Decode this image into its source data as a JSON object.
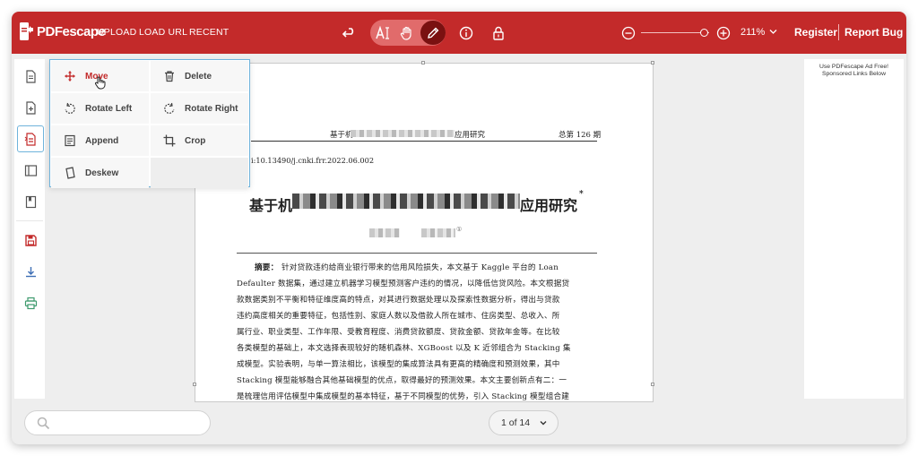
{
  "app": {
    "name": "PDFescape"
  },
  "nav": {
    "upload": "UPLOAD",
    "load_url": "LOAD URL",
    "recent": "RECENT"
  },
  "zoom": {
    "value": "211%",
    "level": 0.94
  },
  "account": {
    "register": "Register",
    "report_bug": "Report Bug"
  },
  "menu": {
    "items": [
      {
        "label": "Move",
        "icon": "move-icon",
        "selected": true
      },
      {
        "label": "Delete",
        "icon": "trash-icon"
      },
      {
        "label": "Rotate Left",
        "icon": "rotate-left-icon"
      },
      {
        "label": "Rotate Right",
        "icon": "rotate-right-icon"
      },
      {
        "label": "Append",
        "icon": "append-icon"
      },
      {
        "label": "Crop",
        "icon": "crop-icon"
      },
      {
        "label": "Deskew",
        "icon": "deskew-icon"
      }
    ]
  },
  "ad": {
    "line1": "Use PDFescape Ad Free!",
    "line2": "Sponsored Links Below"
  },
  "document": {
    "header_left": "基于机",
    "header_right_tail": "应用研究",
    "issue": "总第 126 期",
    "doi": "i:10.13490/j.cnki.frr.2022.06.002",
    "title_start": "基于机",
    "title_end": "应用研究",
    "title_mark": "*",
    "footnote_mark": "①",
    "abstract_label": "摘要：",
    "abstract_lines": [
      "针对贷款违约给商业银行带来的信用风险损失，本文基于 Kaggle 平台的 Loan",
      "Defaulter 数据集，通过建立机器学习模型预测客户违约的情况，以降低信贷风险。本文根据贷",
      "款数据类别不平衡和特征维度高的特点，对其进行数据处理以及探索性数据分析，得出与贷款",
      "违约高度相关的重要特征，包括性别、家庭人数以及借款人所在城市、住房类型、总收入、所",
      "属行业、职业类型、工作年限、受教育程度、消费贷款额度、贷款金额、贷款年金等。在比较",
      "各类模型的基础上，本文选择表现较好的随机森林、XGBoost 以及 K 近邻组合为 Stacking 集",
      "成模型。实验表明，与单一算法相比，该模型的集成算法具有更高的精确度和预测效果，其中",
      "Stacking 模型能够融合其他基础模型的优点，取得最好的预测效果。本文主要创新点有二：一",
      "是梳理信用评估模型中集成模型的基本特征，基于不同模型的优势，引入 Stacking 模型组合建"
    ]
  },
  "pager": {
    "text": "1 of 14"
  },
  "colors": {
    "brand": "#c32a2a",
    "accent": "#6fb3db",
    "active_tool": "#7a1111"
  }
}
